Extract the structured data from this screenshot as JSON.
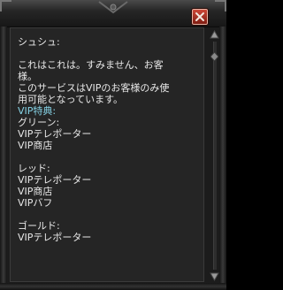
{
  "npc_dialog": {
    "speaker": "シュシュ:",
    "lines": [
      "これはこれは。すみません、お客",
      "様。",
      "このサービスはVIPのお客様のみ使",
      "用可能となっています。",
      "VIP特典:",
      "グリーン:",
      "VIPテレポーター",
      "VIP商店",
      "レッド:",
      "VIPテレポーター",
      "VIP商店",
      "VIPバフ",
      "ゴールド:",
      "VIPテレポーター"
    ]
  },
  "colors": {
    "text": "#e8e8e8",
    "highlight": "#86d3e6",
    "panel": "#252525",
    "close_button": "#c03a2a"
  },
  "icons": {
    "close": "close-x-icon",
    "scroll_up": "triangle-up-icon",
    "scroll_down": "triangle-down-icon"
  }
}
